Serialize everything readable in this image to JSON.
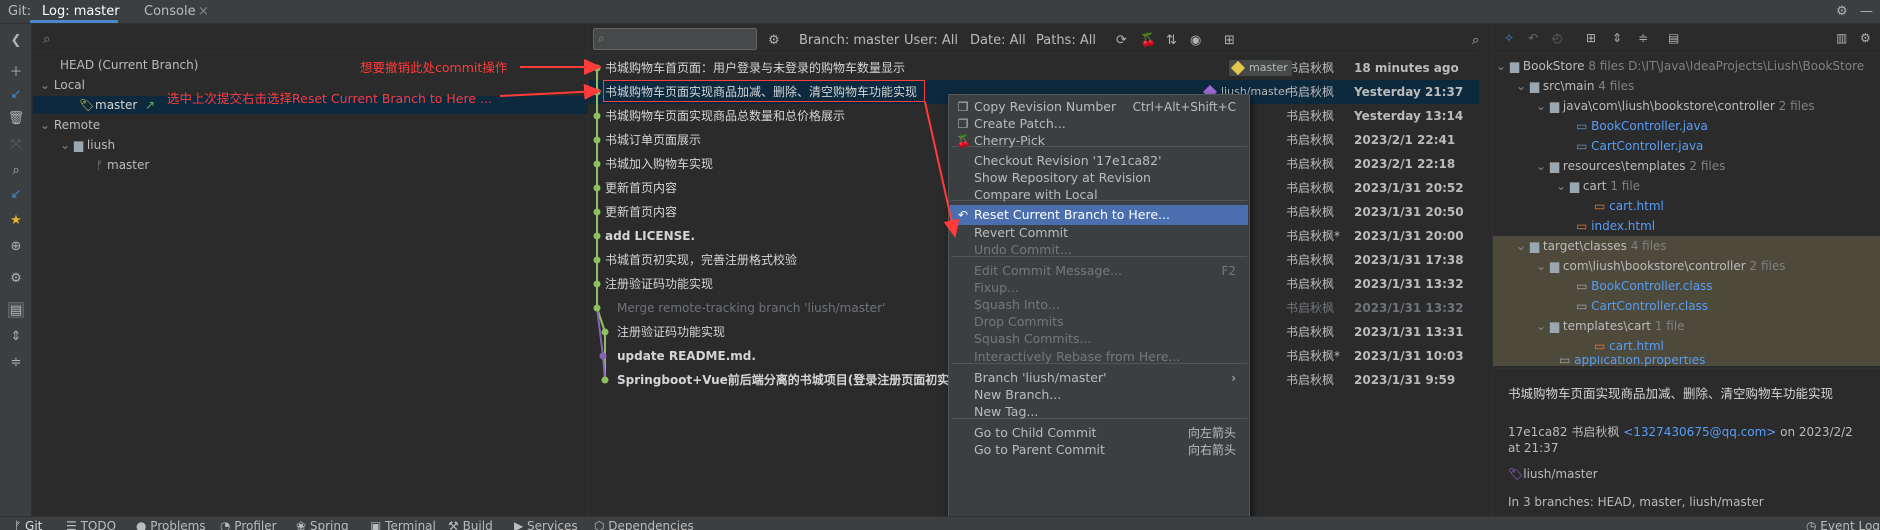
{
  "top_tabs": {
    "git_label": "Git:",
    "log_tab": "Log: master",
    "console_tab": "Console",
    "close_glyph": "×"
  },
  "branches": {
    "search_placeholder": "",
    "head": "HEAD (Current Branch)",
    "local": "Local",
    "local_master": "master",
    "remote": "Remote",
    "remote_group": "liush",
    "remote_master": "master"
  },
  "log_toolbar": {
    "filter_placeholder": "",
    "branch": "Branch: master",
    "user": "User: All",
    "date": "Date: All",
    "paths": "Paths: All"
  },
  "annotations": {
    "a1": "想要撤销此处commit操作",
    "a2": "选中上次提交右击选择Reset Current Branch to Here ..."
  },
  "commits": [
    {
      "msg": "书城购物车首页面：用户登录与未登录的购物车数量显示",
      "author": "书启秋枫",
      "date": "18 minutes ago",
      "tag": "master"
    },
    {
      "msg": "书城购物车页面实现商品加减、删除、清空购物车功能实现",
      "author": "书启秋枫",
      "date": "Yesterday 21:37",
      "tag": "liush/master"
    },
    {
      "msg": "书城购物车页面实现商品总数量和总价格展示",
      "author": "书启秋枫",
      "date": "Yesterday 13:14"
    },
    {
      "msg": "书城订单页面展示",
      "author": "书启秋枫",
      "date": "2023/2/1 22:41"
    },
    {
      "msg": "书城加入购物车实现",
      "author": "书启秋枫",
      "date": "2023/2/1 22:18"
    },
    {
      "msg": "更新首页内容",
      "author": "书启秋枫",
      "date": "2023/1/31 20:52"
    },
    {
      "msg": "更新首页内容",
      "author": "书启秋枫",
      "date": "2023/1/31 20:50"
    },
    {
      "msg": "add LICENSE.",
      "author": "书启秋枫*",
      "date": "2023/1/31 20:00"
    },
    {
      "msg": "书城首页初实现，完善注册格式校验",
      "author": "书启秋枫",
      "date": "2023/1/31 17:38"
    },
    {
      "msg": "注册验证码功能实现",
      "author": "书启秋枫",
      "date": "2023/1/31 13:32"
    },
    {
      "msg": "Merge remote-tracking branch 'liush/master'",
      "author": "书启秋枫",
      "date": "2023/1/31 13:32"
    },
    {
      "msg": "注册验证码功能实现",
      "author": "书启秋枫",
      "date": "2023/1/31 13:31"
    },
    {
      "msg": "update README.md.",
      "author": "书启秋枫*",
      "date": "2023/1/31 10:03"
    },
    {
      "msg": "Springboot+Vue前后端分离的书城项目(登录注册页面初实现",
      "author": "书启秋枫",
      "date": "2023/1/31 9:59"
    }
  ],
  "menu": [
    {
      "label": "Copy Revision Number",
      "shortcut": "Ctrl+Alt+Shift+C"
    },
    {
      "label": "Create Patch..."
    },
    {
      "label": "Cherry-Pick"
    },
    {
      "label": "Checkout Revision '17e1ca82'"
    },
    {
      "label": "Show Repository at Revision"
    },
    {
      "label": "Compare with Local"
    },
    {
      "label": "Reset Current Branch to Here..."
    },
    {
      "label": "Revert Commit"
    },
    {
      "label": "Undo Commit..."
    },
    {
      "label": "Edit Commit Message...",
      "shortcut": "F2"
    },
    {
      "label": "Fixup..."
    },
    {
      "label": "Squash Into..."
    },
    {
      "label": "Drop Commits"
    },
    {
      "label": "Squash Commits..."
    },
    {
      "label": "Interactively Rebase from Here..."
    },
    {
      "label": "Branch 'liush/master'",
      "shortcut": "›"
    },
    {
      "label": "New Branch..."
    },
    {
      "label": "New Tag..."
    },
    {
      "label": "Go to Child Commit",
      "shortcut": "向左箭头"
    },
    {
      "label": "Go to Parent Commit",
      "shortcut": "向右箭头"
    }
  ],
  "files": {
    "root": "BookStore",
    "root_count": "8 files",
    "root_path": "D:\\IT\\Java\\IdeaProjects\\Liush\\BookStore",
    "src_main": "src\\main",
    "src_main_count": "4 files",
    "java_pkg": "java\\com\\liush\\bookstore\\controller",
    "java_pkg_count": "2 files",
    "book_ctrl": "BookController.java",
    "cart_ctrl": "CartController.java",
    "res_tmpl": "resources\\templates",
    "res_tmpl_count": "2 files",
    "cart_dir": "cart",
    "cart_dir_count": "1 file",
    "cart_html": "cart.html",
    "index_html": "index.html",
    "target": "target\\classes",
    "target_count": "4 files",
    "tgt_pkg": "com\\liush\\bookstore\\controller",
    "tgt_pkg_count": "2 files",
    "book_class": "BookController.class",
    "cart_class": "CartController.class",
    "tgt_tmpl": "templates\\cart",
    "tgt_tmpl_count": "1 file",
    "tgt_cart_html": "cart.html",
    "app_props": "application.properties"
  },
  "details": {
    "message": "书城购物车页面实现商品加减、删除、清空购物车功能实现",
    "hash": "17e1ca82",
    "author": "书启秋枫",
    "email": "<1327430675@qq.com>",
    "on_date": "on 2023/2/2",
    "at_time": "at 21:37",
    "ref": "liush/master",
    "branches": "In 3 branches: HEAD, master, liush/master"
  },
  "bottom": {
    "git": "Git",
    "todo": "TODO",
    "problems": "Problems",
    "profiler": "Profiler",
    "spring": "Spring",
    "terminal": "Terminal",
    "build": "Build",
    "services": "Services",
    "dependencies": "Dependencies",
    "event_log": "Event Log"
  },
  "colors": {
    "accent": "#4b6eaf",
    "selection": "#0d293e",
    "annotation": "#ff3b3b",
    "graph": "#8fbf5f",
    "graph_merge": "#8664b4",
    "tag_local": "#e4c84c",
    "tag_remote": "#9d6bd6"
  }
}
